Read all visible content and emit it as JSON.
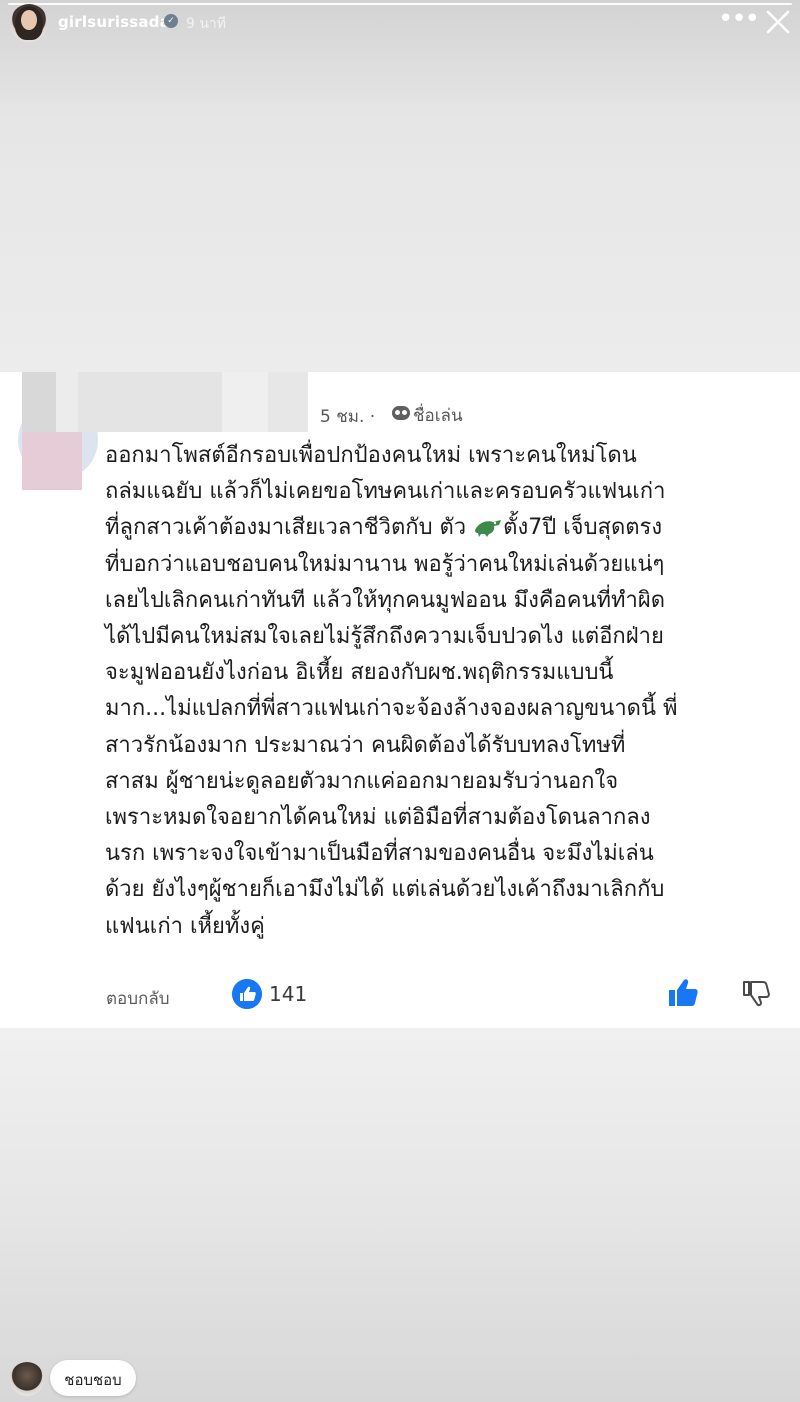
{
  "story": {
    "username": "girlsurissada",
    "time": "9 นาที",
    "more_icon": "more-horizontal-icon",
    "close_icon": "close-icon"
  },
  "comment": {
    "time": "5 ชม.",
    "separator": "·",
    "nickname_label": "ชื่อเล่น",
    "lines": [
      "ออกมาโพสต์อีกรอบเพื่อปกป้องคนใหม่ เพราะคนใหม่โดน",
      "ถล่มแฉยับ แล้วก็ไม่เคยขอโทษคนเก่าและครอบครัวแฟนเก่า",
      "ที่ลูกสาวเค้าต้องมาเสียเวลาชีวิตกับ ตัว",
      "ที่บอกว่าแอบชอบคนใหม่มานาน พอรู้ว่าคนใหม่เล่นด้วยแน่ๆ",
      "เลยไปเลิกคนเก่าทันที แล้วให้ทุกคนมูฟออน มึงคือคนที่ทำผิด",
      "ได้ไปมีคนใหม่สมใจเลยไม่รู้สึกถึงความเจ็บปวดไง แต่อีกฝ่าย",
      "จะมูฟออนยังไงก่อน อิเหี้ย สยองกับผช.พฤติกรรมแบบนี้",
      "มาก...ไม่แปลกที่พี่สาวแฟนเก่าจะจ้องล้างจองผลาญขนาดนี้ พี่",
      "สาวรักน้องมาก ประมาณว่า คนผิดต้องได้รับบทลงโทษที่",
      "สาสม ผู้ชายน่ะดูลอยตัวมากแค่ออกมายอมรับว่านอกใจ",
      "เพราะหมดใจอยากได้คนใหม่ แต่อิมือที่สามต้องโดนลากลง",
      "นรก เพราะจงใจเข้ามาเป็นมือที่สามของคนอื่น จะมึงไม่เล่น",
      "ด้วย ยังไงๆผู้ชายก็เอามึงไม่ได้ แต่เล่นด้วยไงเค้าถึงมาเลิกกับ",
      "แฟนเก่า เหี้ยทั้งคู่"
    ],
    "line3_after_icon": "ตั้ง7ปี เจ็บสุดตรง",
    "inline_icon": "crocodile-emoji-icon",
    "reply_label": "ตอบกลับ",
    "like_count": "141",
    "like_color": "#1877f2"
  },
  "reply_bar": {
    "reaction_label": "ชอบชอบ"
  }
}
